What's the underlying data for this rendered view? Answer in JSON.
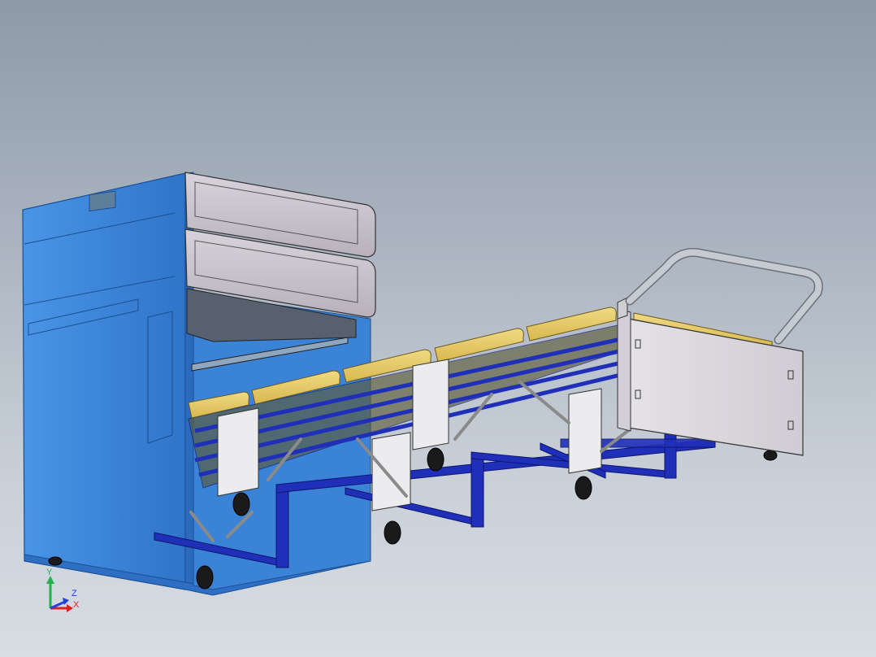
{
  "viewport": {
    "background_top": "#8e9aa8",
    "background_bottom": "#d8dde3"
  },
  "colors": {
    "cabinet_blue": "#3e86d8",
    "cabinet_dark": "#2a67b5",
    "drawer_face": "#c9c3cc",
    "frame_blue": "#1f2fb8",
    "cushion_yellow": "#e9cf6e",
    "panel_grey": "#d9d7dc",
    "handle_silver": "#b9bec4"
  },
  "triad": {
    "y_label": "Y",
    "z_label": "Z",
    "x_label": "X",
    "y_color": "#22b14c",
    "z_color": "#2040e0",
    "x_color": "#e02020"
  }
}
